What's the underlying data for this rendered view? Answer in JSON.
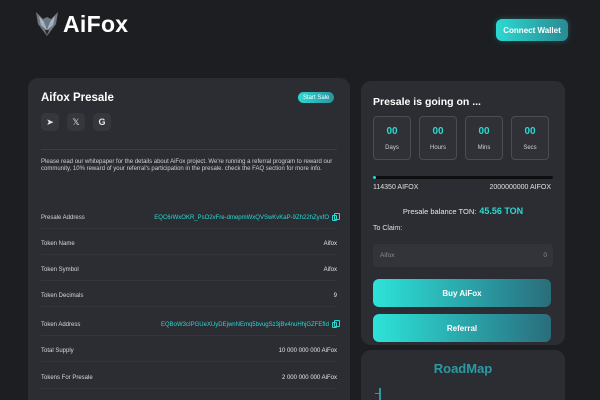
{
  "header": {
    "logo_text": "AiFox",
    "connect_label": "Connect Wallet"
  },
  "presale": {
    "title": "Aifox Presale",
    "badge": "Start Sale",
    "social": [
      {
        "icon": "telegram-icon",
        "glyph": "➤"
      },
      {
        "icon": "x-icon",
        "glyph": "𝕏"
      },
      {
        "icon": "google-icon",
        "glyph": "G"
      }
    ],
    "description": "Please read our whitepaper for the details about AiFox project. We're running a referral program to reward our community, 10% reward of your referral's participation in the presale. check the FAQ section for more info.",
    "rows": [
      {
        "label": "Presale Address",
        "value": "EQC6rWxOKR_PsO2vFre-dmepmWxQVSwKvKaP-9Zh22hZyxfO",
        "link": true
      },
      {
        "label": "Token Name",
        "value": "Aifox",
        "link": false
      },
      {
        "label": "Token Symbol",
        "value": "Aifox",
        "link": false
      },
      {
        "label": "Token Decimals",
        "value": "9",
        "link": false
      },
      {
        "label": "Token Address",
        "value": "EQBoW3cIPGUeXUyDEjwnNEmq5bvugSz3jBv4nuHhjGZFEfId",
        "link": true
      },
      {
        "label": "Total Supply",
        "value": "10 000 000 000 AiFox",
        "link": false
      },
      {
        "label": "Tokens For Presale",
        "value": "2 000 000 000 AiFox",
        "link": false
      }
    ]
  },
  "status": {
    "title": "Presale is going on ...",
    "countdown": [
      {
        "value": "00",
        "label": "Days"
      },
      {
        "value": "00",
        "label": "Hours"
      },
      {
        "value": "00",
        "label": "Mins"
      },
      {
        "value": "00",
        "label": "Secs"
      }
    ],
    "progress_fraction": 5.72e-05,
    "progress_left": "114350 AIFOX",
    "progress_right": "2000000000 AIFOX",
    "balance_label": "Presale balance TON:",
    "balance_value": "45.56 TON",
    "claim_label": "To Claim:",
    "claim_token": "Aifox",
    "claim_value": "0",
    "buy_label": "Buy AiFox",
    "referral_label": "Referral"
  },
  "roadmap": {
    "title": "RoadMap"
  },
  "colors": {
    "accent": "#2bd9d1",
    "background": "#1d1e22",
    "card": "#2b2d33"
  }
}
